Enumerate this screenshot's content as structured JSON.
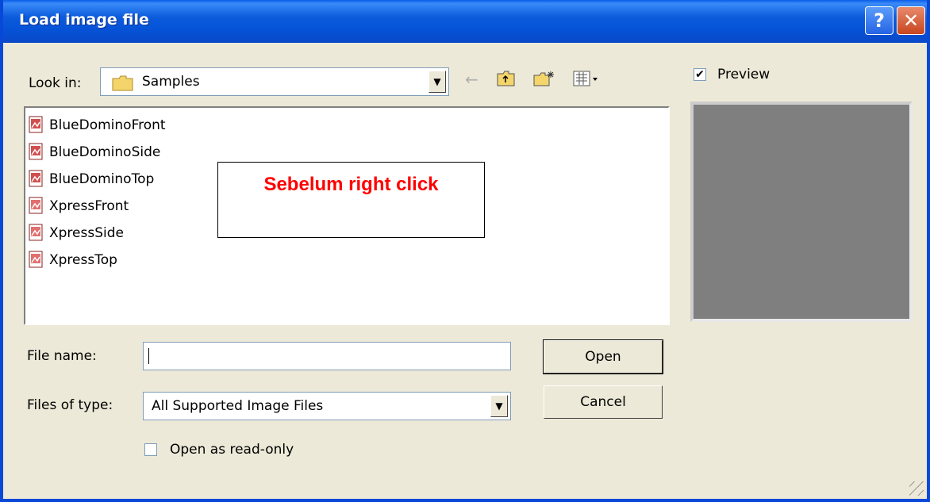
{
  "window": {
    "title": "Load image file",
    "help_symbol": "?",
    "close_symbol": "✕"
  },
  "lookin": {
    "label": "Look in:",
    "value": "Samples",
    "folder_icon": "folder-icon"
  },
  "toolbar": {
    "back_icon": "←",
    "up_icon": "⇧",
    "newfolder_icon": "✱",
    "views_icon": "▦▾"
  },
  "files": [
    {
      "name": "BlueDominoFront",
      "icon": "image-file-icon"
    },
    {
      "name": "BlueDominoSide",
      "icon": "image-file-icon"
    },
    {
      "name": "BlueDominoTop",
      "icon": "image-file-icon"
    },
    {
      "name": "XpressFront",
      "icon": "image-file-icon"
    },
    {
      "name": "XpressSide",
      "icon": "image-file-icon"
    },
    {
      "name": "XpressTop",
      "icon": "image-file-icon"
    }
  ],
  "annotation": {
    "text": "Sebelum right click"
  },
  "preview": {
    "label": "Preview",
    "checked": true
  },
  "filename": {
    "label": "File name:",
    "value": ""
  },
  "filetype": {
    "label": "Files of type:",
    "value": "All Supported Image Files"
  },
  "buttons": {
    "open": "Open",
    "cancel": "Cancel"
  },
  "readonly": {
    "label": "Open as read-only",
    "checked": false
  },
  "colors": {
    "titlebar": "#0A5DE8",
    "dialog_bg": "#ECE9D8",
    "annotation_text": "#FF0000",
    "preview_bg": "#7F7F7F"
  }
}
